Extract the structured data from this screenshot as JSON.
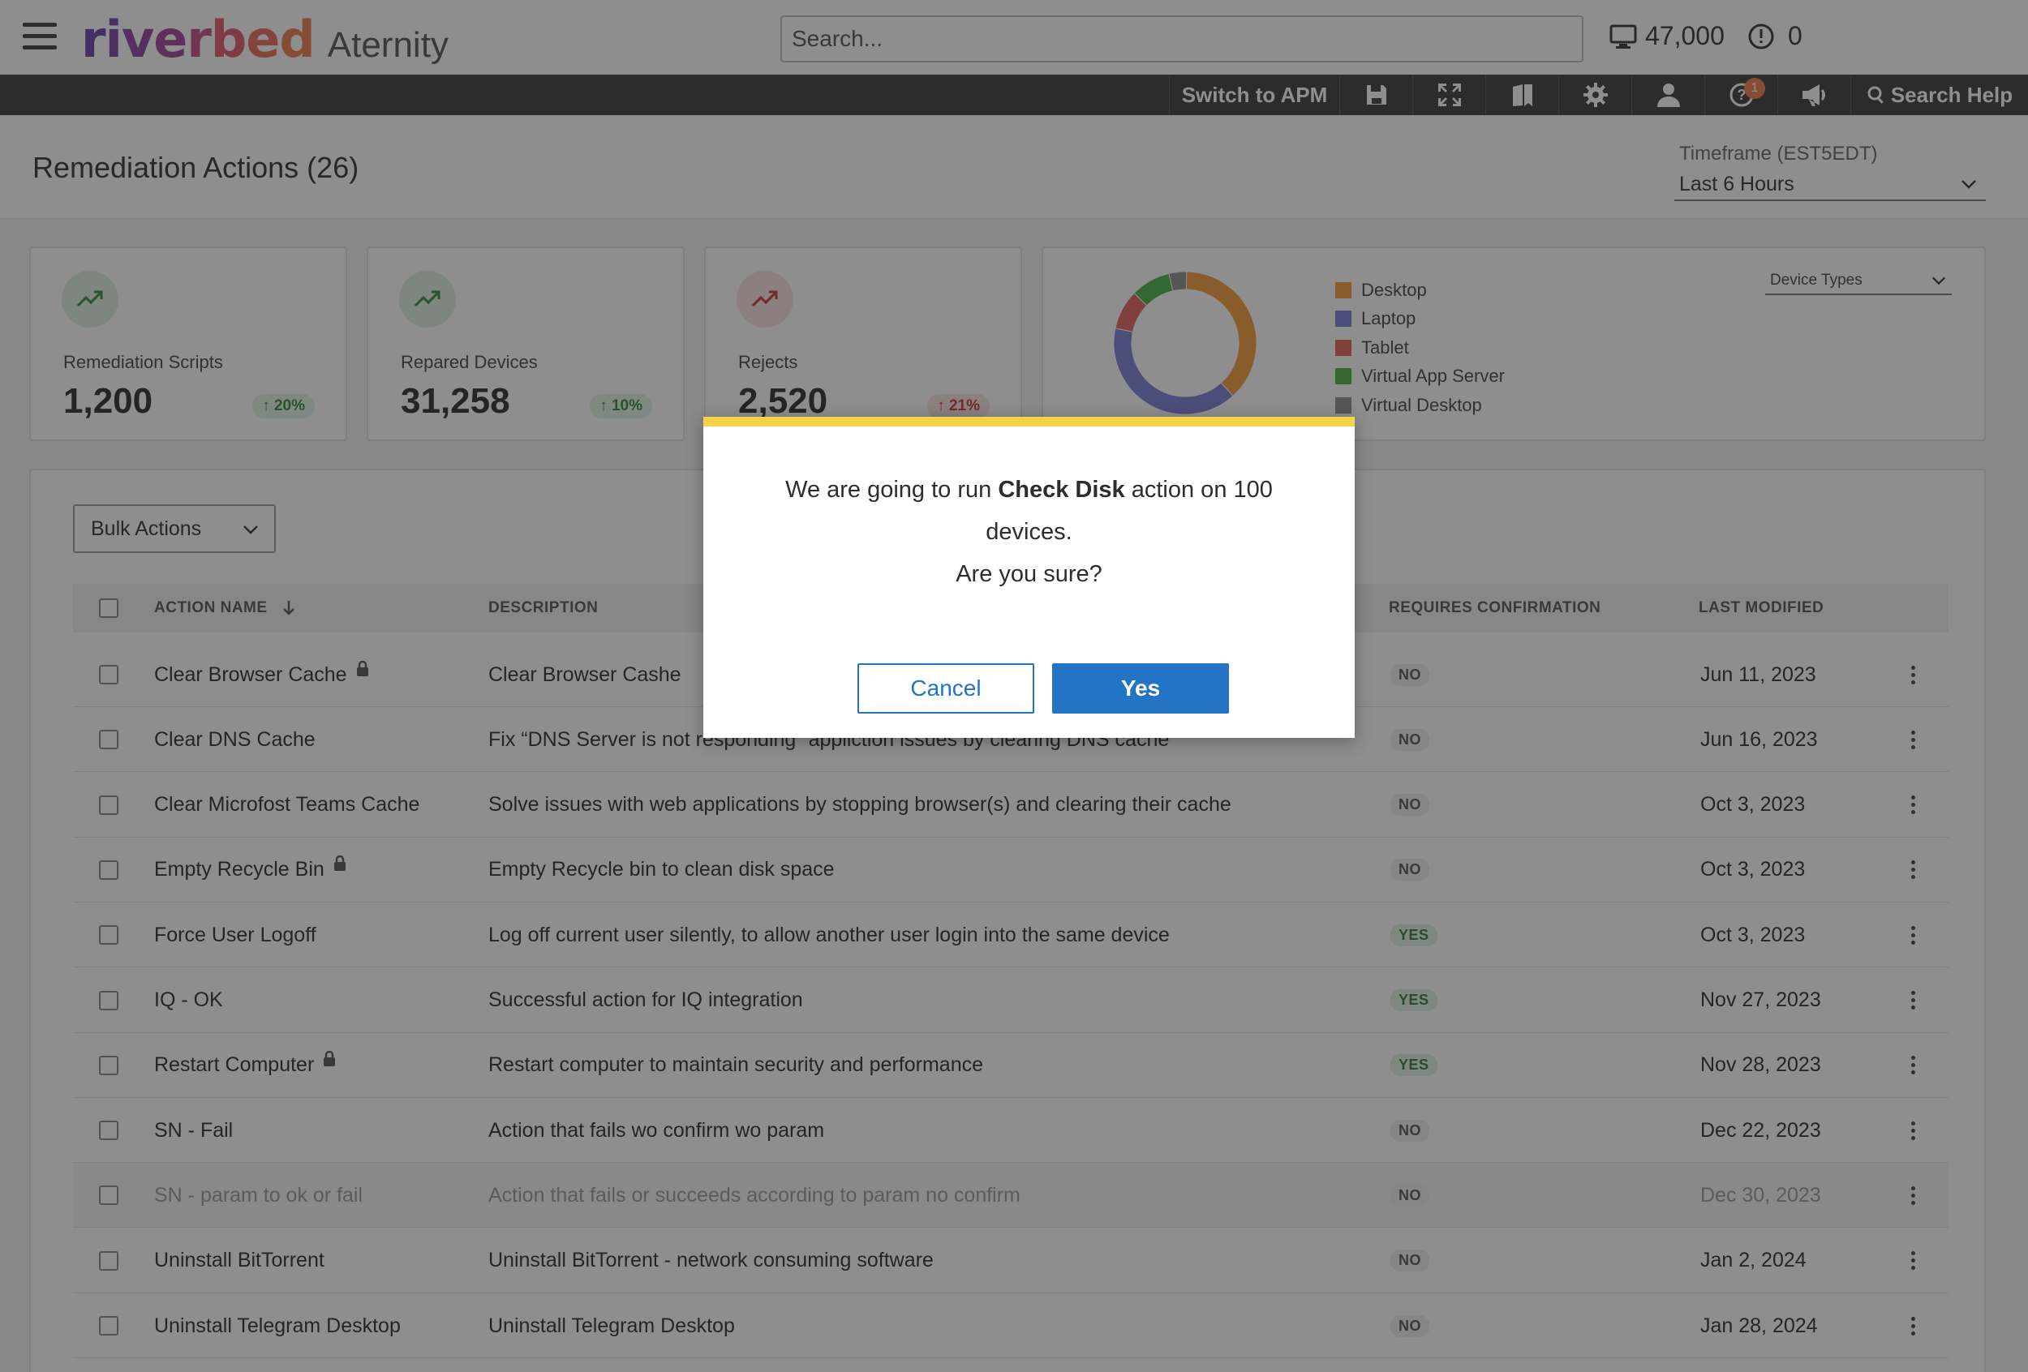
{
  "header": {
    "brand_logo": "riverbed",
    "brand_product": "Aternity",
    "search_placeholder": "Search...",
    "devices_count": "47,000",
    "alerts_count": "0"
  },
  "toolbar": {
    "switch_label": "Switch to APM",
    "help_badge": "1",
    "search_help_label": "Search Help"
  },
  "page": {
    "title": "Remediation Actions (26)",
    "timeframe_label": "Timeframe (EST5EDT)",
    "timeframe_value": "Last 6 Hours"
  },
  "kpis": [
    {
      "label": "Remediation Scripts",
      "value": "1,200",
      "delta": "20%",
      "trend": "up"
    },
    {
      "label": "Repared Devices",
      "value": "31,258",
      "delta": "10%",
      "trend": "up"
    },
    {
      "label": "Rejects",
      "value": "2,520",
      "delta": "21%",
      "trend": "down"
    }
  ],
  "device_chart": {
    "selector_label": "Device Types",
    "legend": [
      "Desktop",
      "Laptop",
      "Tablet",
      "Virtual App Server",
      "Virtual Desktop"
    ],
    "colors": {
      "Desktop": "#f29d38",
      "Laptop": "#7a7fd6",
      "Tablet": "#e2645c",
      "Virtual App Server": "#48b04a",
      "Virtual Desktop": "#8e8e8e"
    }
  },
  "chart_data": {
    "type": "pie",
    "categories": [
      "Desktop",
      "Laptop",
      "Tablet",
      "Virtual App Server",
      "Virtual Desktop"
    ],
    "values": [
      38,
      40,
      9,
      9,
      4
    ]
  },
  "table": {
    "bulk_actions_label": "Bulk Actions",
    "columns": {
      "name": "ACTION NAME",
      "description": "DESCRIPTION",
      "requires_confirmation": "REQUIRES CONFIRMATION",
      "last_modified": "LAST MODIFIED"
    },
    "rows": [
      {
        "name": "Clear Browser Cache",
        "locked": true,
        "description": "Clear Browser Cashe",
        "confirm": "NO",
        "modified": "Jun 11, 2023"
      },
      {
        "name": "Clear DNS Cache",
        "locked": false,
        "description": "Fix “DNS Server is not responding” appliction issues by clearing DNS cache",
        "confirm": "NO",
        "modified": "Jun 16, 2023"
      },
      {
        "name": "Clear Microfost Teams Cache",
        "locked": false,
        "description": "Solve issues with web applications by stopping browser(s) and clearing their cache",
        "confirm": "NO",
        "modified": "Oct 3, 2023"
      },
      {
        "name": "Empty Recycle Bin",
        "locked": true,
        "description": "Empty Recycle bin to clean disk space",
        "confirm": "NO",
        "modified": "Oct 3, 2023"
      },
      {
        "name": "Force User Logoff",
        "locked": false,
        "description": "Log off current user silently, to allow another user login into the same device",
        "confirm": "YES",
        "modified": "Oct 3, 2023"
      },
      {
        "name": "IQ - OK",
        "locked": false,
        "description": "Successful action for IQ integration",
        "confirm": "YES",
        "modified": "Nov 27, 2023"
      },
      {
        "name": "Restart Computer",
        "locked": true,
        "description": "Restart computer to maintain security and performance",
        "confirm": "YES",
        "modified": "Nov 28, 2023"
      },
      {
        "name": "SN - Fail",
        "locked": false,
        "description": "Action that fails wo confirm wo param",
        "confirm": "NO",
        "modified": "Dec 22, 2023"
      },
      {
        "name": "SN - param to ok or fail",
        "locked": false,
        "muted": true,
        "description": "Action that fails or succeeds according to param no confirm",
        "confirm": "NO",
        "modified": "Dec 30, 2023"
      },
      {
        "name": "Uninstall BitTorrent",
        "locked": false,
        "description": "Uninstall BitTorrent - network consuming software",
        "confirm": "NO",
        "modified": "Jan 2, 2024"
      },
      {
        "name": "Uninstall Telegram Desktop",
        "locked": false,
        "description": "Uninstall Telegram Desktop",
        "confirm": "NO",
        "modified": "Jan 28, 2024"
      }
    ]
  },
  "dialog": {
    "msg_prefix": "We are going to run ",
    "action_name": "Check Disk",
    "msg_suffix": "  action on 100 devices.",
    "question": "Are you sure?",
    "cancel_label": "Cancel",
    "yes_label": "Yes",
    "accent": "#f8d34a",
    "primary": "#2374c4"
  }
}
